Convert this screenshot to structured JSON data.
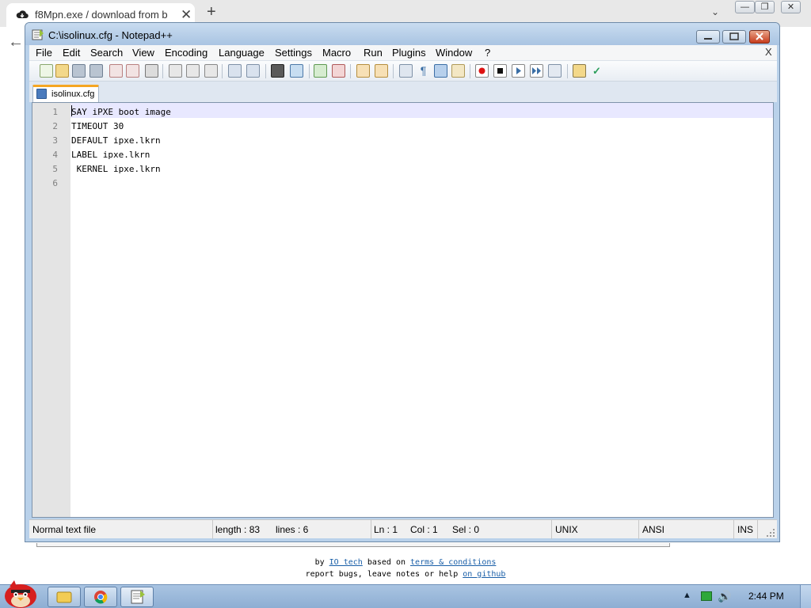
{
  "browser": {
    "tab_title": "f8Mpn.exe / download from b",
    "tab_close": "✕",
    "new_tab": "+",
    "tab_dropdown": "⌄",
    "back": "←",
    "window_controls": {
      "minimize": "—",
      "restore": "❐",
      "close": "✕"
    }
  },
  "page": {
    "footer_line1_prefix": "by ",
    "footer_author": "IO tech",
    "footer_line1_mid": " based on ",
    "footer_terms": "terms & conditions",
    "footer_line2_prefix": "report bugs, leave notes or help ",
    "footer_github": "on github"
  },
  "notepad": {
    "title": "C:\\isolinux.cfg - Notepad++",
    "doc_close": "X",
    "menu": [
      "File",
      "Edit",
      "Search",
      "View",
      "Encoding",
      "Language",
      "Settings",
      "Macro",
      "Run",
      "Plugins",
      "Window",
      "?"
    ],
    "tab_label": "isolinux.cfg",
    "line_numbers": [
      "1",
      "2",
      "3",
      "4",
      "5",
      "6"
    ],
    "lines": [
      "SAY iPXE boot image",
      "TIMEOUT 30",
      "DEFAULT ipxe.lkrn",
      "LABEL ipxe.lkrn",
      " KERNEL ipxe.lkrn",
      ""
    ],
    "status": {
      "file_type": "Normal text file",
      "length": "length : 83",
      "lines": "lines : 6",
      "ln": "Ln : 1",
      "col": "Col : 1",
      "sel": "Sel : 0",
      "eol": "UNIX",
      "encoding": "ANSI",
      "mode": "INS"
    }
  },
  "taskbar": {
    "clock": "2:44 PM",
    "tray_arrow": "▲",
    "volume": "🔊"
  },
  "colors": {
    "current_line": "#e8e8ff",
    "gutter": "#e4e4e4",
    "link": "#1a5fa8",
    "tab_accent": "#f5a623"
  }
}
